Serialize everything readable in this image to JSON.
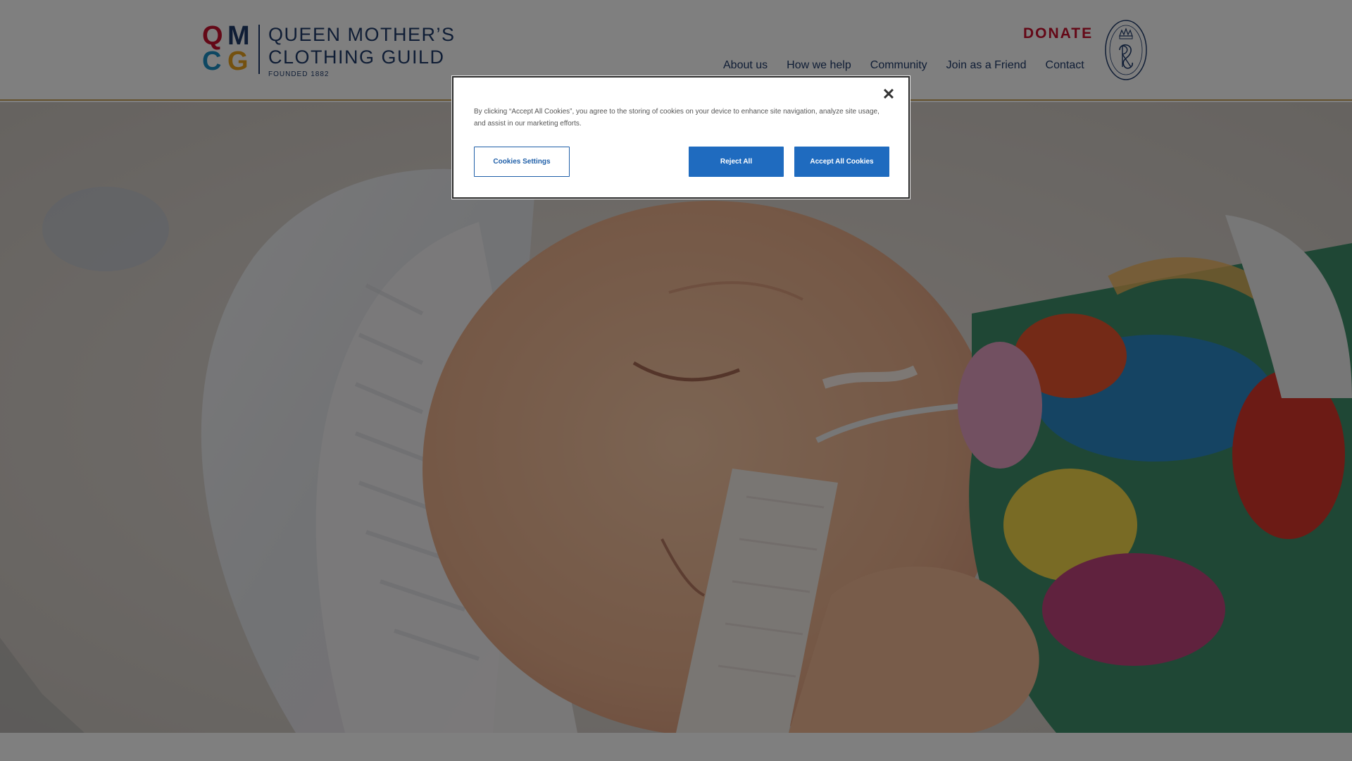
{
  "header": {
    "logo": {
      "letters": [
        "Q",
        "M",
        "C",
        "G"
      ],
      "letter_colors": [
        "#c8102e",
        "#1f3a6b",
        "#1a8fc4",
        "#e8a21f"
      ],
      "line1": "QUEEN MOTHER’S",
      "line2": "CLOTHING GUILD",
      "founded": "FOUNDED 1882"
    },
    "donate_label": "DONATE",
    "nav": [
      "About us",
      "How we help",
      "Community",
      "Join as a Friend",
      "Contact"
    ]
  },
  "hero": {
    "image": "sleeping newborn baby in knitted hat with feeding tube"
  },
  "cookie_banner": {
    "text": "By clicking “Accept All Cookies”, you agree to the storing of cookies on your device to enhance site navigation, analyze site usage, and assist in our marketing efforts.",
    "close_icon": "close-icon",
    "settings_label": "Cookies Settings",
    "reject_label": "Reject All",
    "accept_label": "Accept All Cookies"
  },
  "colors": {
    "brand_navy": "#1f3a6b",
    "donate_red": "#c8102e",
    "button_blue": "#1f6bbf",
    "header_border": "#c9a35b"
  }
}
